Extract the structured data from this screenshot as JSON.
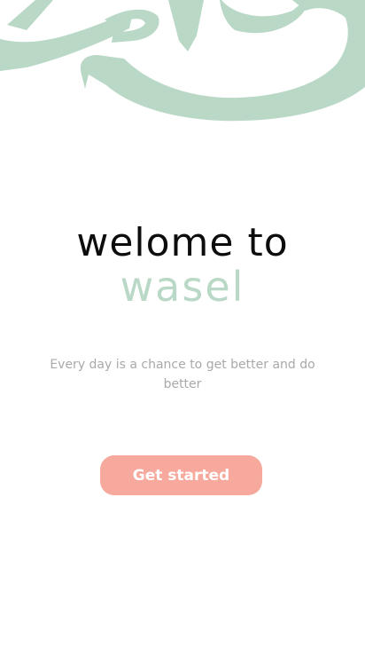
{
  "colors": {
    "accent": "#b9d8c6",
    "button": "#f6a99c",
    "title": "#0d0d0d",
    "tagline": "#a9a9a9"
  },
  "decoration": {
    "icon": "arabic-calligraphy-icon"
  },
  "welcome": {
    "title": "welome to",
    "brand": "wasel"
  },
  "tagline": "Every day is a chance to get better and do better",
  "cta": {
    "label": "Get started"
  }
}
